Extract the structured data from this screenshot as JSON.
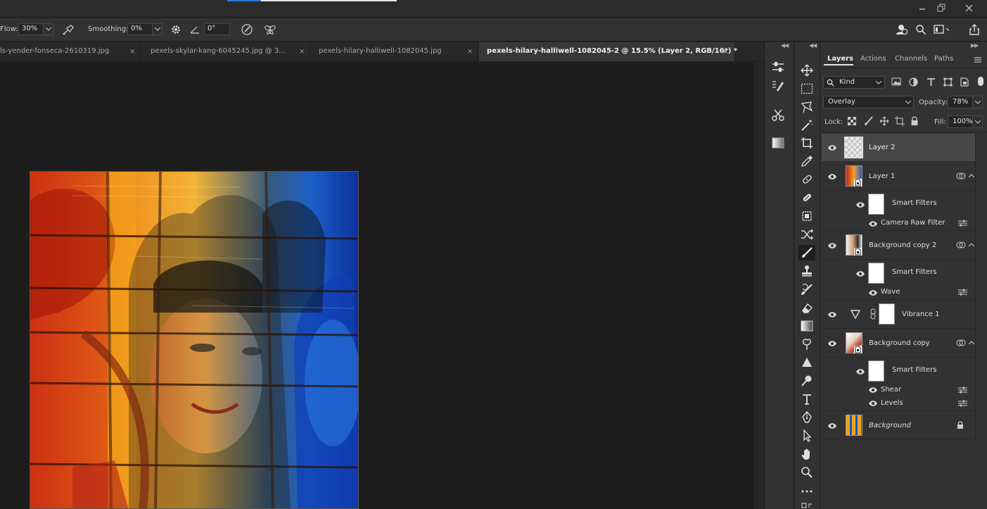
{
  "options_bar": {
    "flow_label": "Flow:",
    "flow_value": "30%",
    "smoothing_label": "Smoothing:",
    "smoothing_value": "0%",
    "angle_value": "0°"
  },
  "tabs": [
    {
      "label": "ls-yender-fonseca-2610319.jpg"
    },
    {
      "label": "pexels-skylar-kang-6045245.jpg @ 3..."
    },
    {
      "label": "pexels-hilary-halliwell-1082045.jpg"
    },
    {
      "label": "pexels-hilary-halliwell-1082045-2 @ 15.5% (Layer 2, RGB/16*) *"
    }
  ],
  "tab_close_glyph": "×",
  "panel_tabs": [
    "Layers",
    "Actions",
    "Channels",
    "Paths"
  ],
  "layers_panel": {
    "filter_kind": "Kind",
    "blend_mode": "Overlay",
    "opacity_label": "Opacity:",
    "opacity_value": "78%",
    "lock_label": "Lock:",
    "fill_label": "Fill:",
    "fill_value": "100%"
  },
  "layers": [
    {
      "name": "Layer 2",
      "selected": true
    },
    {
      "name": "Layer 1"
    },
    {
      "name": "Smart Filters"
    },
    {
      "name": "Camera Raw Filter"
    },
    {
      "name": "Background copy 2"
    },
    {
      "name": "Smart Filters"
    },
    {
      "name": "Wave"
    },
    {
      "name": "Vibrance 1"
    },
    {
      "name": "Background copy"
    },
    {
      "name": "Smart Filters"
    },
    {
      "name": "Shear"
    },
    {
      "name": "Levels"
    },
    {
      "name": "Background"
    }
  ],
  "colors": {
    "panel_bg": "#323232",
    "canvas_bg": "#1d1d1d",
    "accent_blue": "#2f79d6",
    "selected_row": "#474747"
  }
}
